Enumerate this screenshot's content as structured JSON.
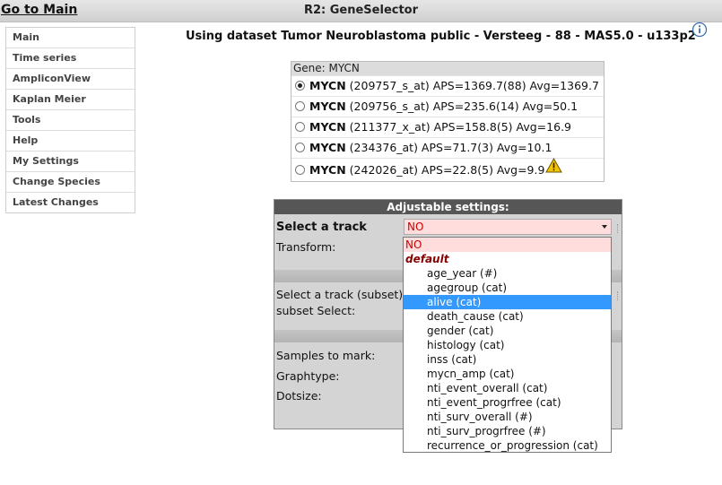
{
  "header": {
    "goto_main": "Go to Main",
    "title": "R2: GeneSelector"
  },
  "sidebar": {
    "items": [
      {
        "label": "Main"
      },
      {
        "label": "Time series"
      },
      {
        "label": "AmpliconView"
      },
      {
        "label": "Kaplan Meier"
      },
      {
        "label": "Tools"
      },
      {
        "label": "Help"
      },
      {
        "label": "My Settings"
      },
      {
        "label": "Change Species"
      },
      {
        "label": "Latest Changes"
      }
    ]
  },
  "dataset_line": "Using dataset Tumor Neuroblastoma public - Versteeg - 88 - MAS5.0 - u133p2",
  "gene_table": {
    "header": "Gene: MYCN",
    "rows": [
      {
        "symbol": "MYCN",
        "details": "(209757_s_at) APS=1369.7(88) Avg=1369.7",
        "selected": true,
        "warning": false
      },
      {
        "symbol": "MYCN",
        "details": "(209756_s_at) APS=235.6(14) Avg=50.1",
        "selected": false,
        "warning": false
      },
      {
        "symbol": "MYCN",
        "details": "(211377_x_at) APS=158.8(5) Avg=16.9",
        "selected": false,
        "warning": false
      },
      {
        "symbol": "MYCN",
        "details": "(234376_at) APS=71.7(3) Avg=10.1",
        "selected": false,
        "warning": false
      },
      {
        "symbol": "MYCN",
        "details": "(242026_at) APS=22.8(5) Avg=9.9",
        "selected": false,
        "warning": true
      }
    ]
  },
  "settings": {
    "header": "Adjustable settings:",
    "select_track_label": "Select a track",
    "transform_label": "Transform:",
    "select_track_subset_label": "Select a track (subset)",
    "subset_select_label": "subset Select:",
    "samples_to_mark_label": "Samples to mark:",
    "graphtype_label": "Graphtype:",
    "dotsize_label": "Dotsize:",
    "track_select_value": "NO"
  },
  "dropdown": {
    "none_option": "NO",
    "group_label": "default",
    "selected_option": "alive (cat)",
    "options": [
      "age_year (#)",
      "agegroup (cat)",
      "alive (cat)",
      "death_cause (cat)",
      "gender (cat)",
      "histology (cat)",
      "inss (cat)",
      "mycn_amp (cat)",
      "nti_event_overall (cat)",
      "nti_event_progrfree (cat)",
      "nti_surv_overall (#)",
      "nti_surv_progrfree (#)",
      "recurrence_or_progression (cat)"
    ]
  },
  "colors": {
    "accent_selected": "#3399ff",
    "no_option_bg": "#ffdddd",
    "group_label": "#880000",
    "settings_header_bg": "#565656"
  },
  "icons": [
    "info-icon",
    "warning-icon",
    "dropdown-arrow-icon"
  ]
}
